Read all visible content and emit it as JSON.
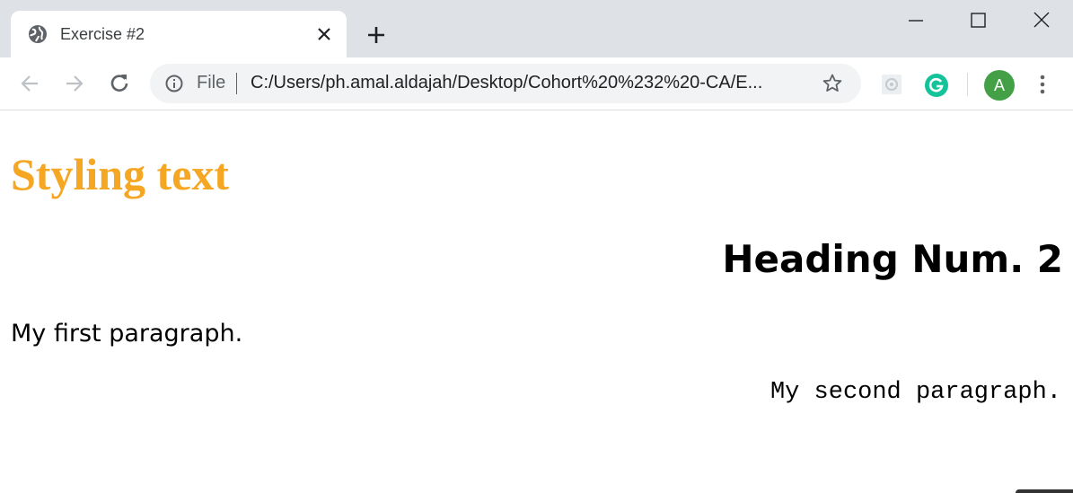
{
  "browser": {
    "tab": {
      "title": "Exercise #2"
    },
    "address": {
      "scheme_label": "File",
      "url": "C:/Users/ph.amal.aldajah/Desktop/Cohort%20%232%20-CA/E..."
    },
    "profile_initial": "A",
    "icons": [
      "globe-icon",
      "close-icon",
      "plus-icon",
      "minimize-icon",
      "maximize-icon",
      "window-close-icon",
      "back-arrow-icon",
      "forward-arrow-icon",
      "reload-icon",
      "info-icon",
      "star-icon",
      "extension-icon",
      "grammarly-icon",
      "menu-icon"
    ]
  },
  "page": {
    "heading1": "Styling text",
    "heading2": "Heading Num. 2",
    "paragraph1": "My first paragraph.",
    "paragraph2": "My second paragraph."
  },
  "colors": {
    "heading1": "#f5a623",
    "tabstrip": "#dee1e6",
    "avatar": "#43a047",
    "grammarly": "#15c39a"
  }
}
